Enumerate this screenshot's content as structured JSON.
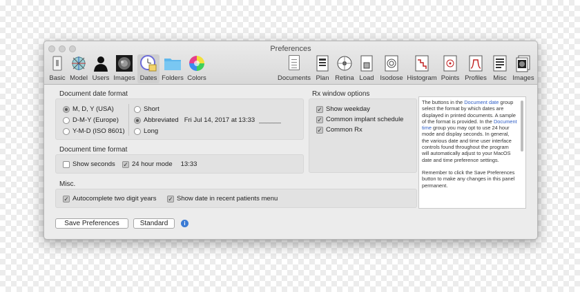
{
  "window": {
    "title": "Preferences"
  },
  "toolbar_left": [
    {
      "label": "Basic"
    },
    {
      "label": "Model"
    },
    {
      "label": "Users"
    },
    {
      "label": "Images"
    },
    {
      "label": "Dates",
      "selected": true
    },
    {
      "label": "Folders"
    },
    {
      "label": "Colors"
    }
  ],
  "toolbar_right": [
    {
      "label": "Documents"
    },
    {
      "label": "Plan"
    },
    {
      "label": "Retina"
    },
    {
      "label": "Load"
    },
    {
      "label": "Isodose"
    },
    {
      "label": "Histogram"
    },
    {
      "label": "Points"
    },
    {
      "label": "Profiles"
    },
    {
      "label": "Misc"
    },
    {
      "label": "Images"
    }
  ],
  "date_format": {
    "title": "Document date format",
    "order_options": [
      {
        "label": "M, D, Y (USA)",
        "selected": true
      },
      {
        "label": "D-M-Y (Europe)",
        "selected": false
      },
      {
        "label": "Y-M-D (ISO 8601)",
        "selected": false
      }
    ],
    "style_options": [
      {
        "label": "Short",
        "selected": false
      },
      {
        "label": "Abbreviated",
        "selected": true
      },
      {
        "label": "Long",
        "selected": false
      }
    ],
    "preview": "Fri Jul 14, 2017 at 13:33",
    "preview_blank": "______"
  },
  "time_format": {
    "title": "Document time format",
    "show_seconds": {
      "label": "Show seconds",
      "checked": false
    },
    "hour24": {
      "label": "24 hour mode",
      "checked": true
    },
    "preview": "13:33"
  },
  "misc": {
    "title": "Misc.",
    "autocomplete": {
      "label": "Autocomplete two digit years",
      "checked": true
    },
    "show_date": {
      "label": "Show date in recent patients menu",
      "checked": true
    }
  },
  "rx": {
    "title": "Rx window options",
    "options": [
      {
        "label": "Show weekday",
        "checked": true
      },
      {
        "label": "Common implant schedule",
        "checked": true
      },
      {
        "label": "Common Rx",
        "checked": true
      }
    ]
  },
  "help": {
    "p1_a": "The buttons in the ",
    "p1_link1": "Document date",
    "p1_b": " group select the format by which dates are displayed in printed documents. A sample of the format is provided. In the ",
    "p1_link2": "Document time",
    "p1_c": " group you may opt to use 24 hour mode and display seconds. In general, the various date and time user interface controls found throughout the program will automatically adjust to your MacOS date and time preference settings.",
    "p2": "Remember to click the Save Preferences button to make any changes in this panel permanent."
  },
  "buttons": {
    "save": "Save Preferences",
    "standard": "Standard",
    "info": "i"
  },
  "colors": {
    "link": "#2d5cc5",
    "info": "#3b7bd4"
  }
}
